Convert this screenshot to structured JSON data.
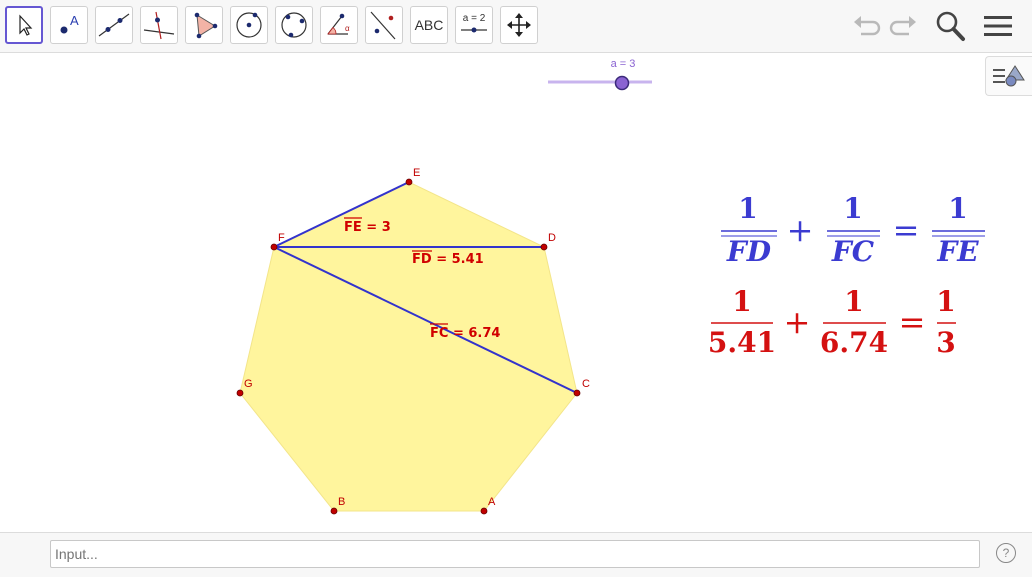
{
  "toolbar": {
    "tools": [
      {
        "name": "move",
        "icon": "move-arrow-icon"
      },
      {
        "name": "point",
        "icon": "point-icon"
      },
      {
        "name": "line",
        "icon": "line-icon"
      },
      {
        "name": "perpendicular",
        "icon": "perpendicular-line-icon"
      },
      {
        "name": "polygon",
        "icon": "polygon-icon"
      },
      {
        "name": "circle",
        "icon": "circle-with-center-icon"
      },
      {
        "name": "circle-three-points",
        "icon": "circle-three-points-icon"
      },
      {
        "name": "angle",
        "icon": "angle-icon"
      },
      {
        "name": "reflect",
        "icon": "reflect-about-line-icon"
      },
      {
        "name": "text",
        "label": "ABC"
      },
      {
        "name": "slider",
        "label": "a = 2"
      },
      {
        "name": "move-graphics",
        "icon": "move-graphics-icon"
      }
    ]
  },
  "slider": {
    "label": "a = 3",
    "value": 3
  },
  "points": {
    "A": "A",
    "B": "B",
    "C": "C",
    "D": "D",
    "E": "E",
    "F": "F",
    "G": "G"
  },
  "segments": {
    "FE": {
      "name": "FE",
      "value": "3"
    },
    "FD": {
      "name": "FD",
      "value": "5.41"
    },
    "FC": {
      "name": "FC",
      "value": "6.74"
    }
  },
  "formula": {
    "symbolic": {
      "num": "1",
      "den1": "FD",
      "den2": "FC",
      "den3": "FE",
      "plus": "+",
      "eq": "="
    },
    "numeric": {
      "num": "1",
      "den1": "5.41",
      "den2": "6.74",
      "den3": "3",
      "plus": "+",
      "eq": "="
    }
  },
  "input": {
    "placeholder": "Input..."
  },
  "help": {
    "label": "?"
  },
  "colors": {
    "polygon_fill": "#fff59d",
    "segment": "#3333cc",
    "point": "#c00000",
    "formula_symbolic": "#3b3bd1",
    "formula_numeric": "#d41111",
    "slider": "#8a63d2"
  }
}
